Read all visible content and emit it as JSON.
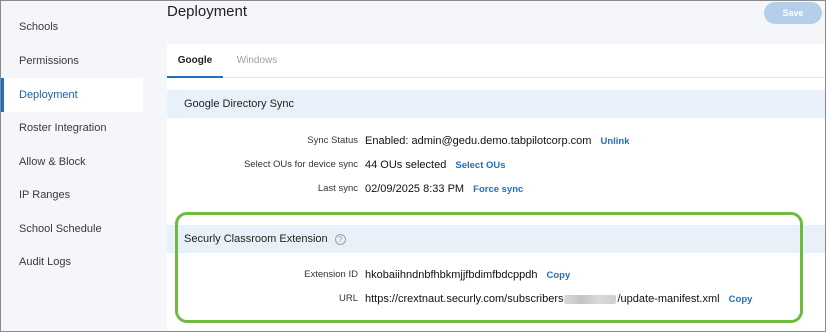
{
  "sidebar": {
    "items": [
      {
        "label": "Schools"
      },
      {
        "label": "Permissions"
      },
      {
        "label": "Deployment"
      },
      {
        "label": "Roster Integration"
      },
      {
        "label": "Allow & Block"
      },
      {
        "label": "IP Ranges"
      },
      {
        "label": "School Schedule"
      },
      {
        "label": "Audit Logs"
      }
    ]
  },
  "header": {
    "title": "Deployment",
    "save_label": "Save"
  },
  "tabs": [
    {
      "label": "Google"
    },
    {
      "label": "Windows"
    }
  ],
  "google_sync": {
    "title": "Google Directory Sync",
    "sync_status_label": "Sync Status",
    "sync_status_value": "Enabled:  admin@gedu.demo.tabpilotcorp.com",
    "unlink_label": "Unlink",
    "ous_label": "Select OUs for device sync",
    "ous_value": "44 OUs selected",
    "select_ous_label": "Select OUs",
    "last_sync_label": "Last sync",
    "last_sync_value": "02/09/2025 8:33 PM",
    "force_sync_label": "Force sync"
  },
  "extension": {
    "title": "Securly Classroom Extension",
    "help_icon": "?",
    "id_label": "Extension ID",
    "id_value": "hkobaiihndnbfhbkmjjfbdimfbdcppdh",
    "id_copy_label": "Copy",
    "url_label": "URL",
    "url_prefix": "https://crextnaut.securly.com/subscribers",
    "url_suffix": "/update-manifest.xml",
    "url_copy_label": "Copy"
  },
  "colors": {
    "accent": "#1f6fc4",
    "highlight": "#6dbb3f",
    "section_bg": "#e8f0fa",
    "save_bg": "#b5cfea"
  }
}
